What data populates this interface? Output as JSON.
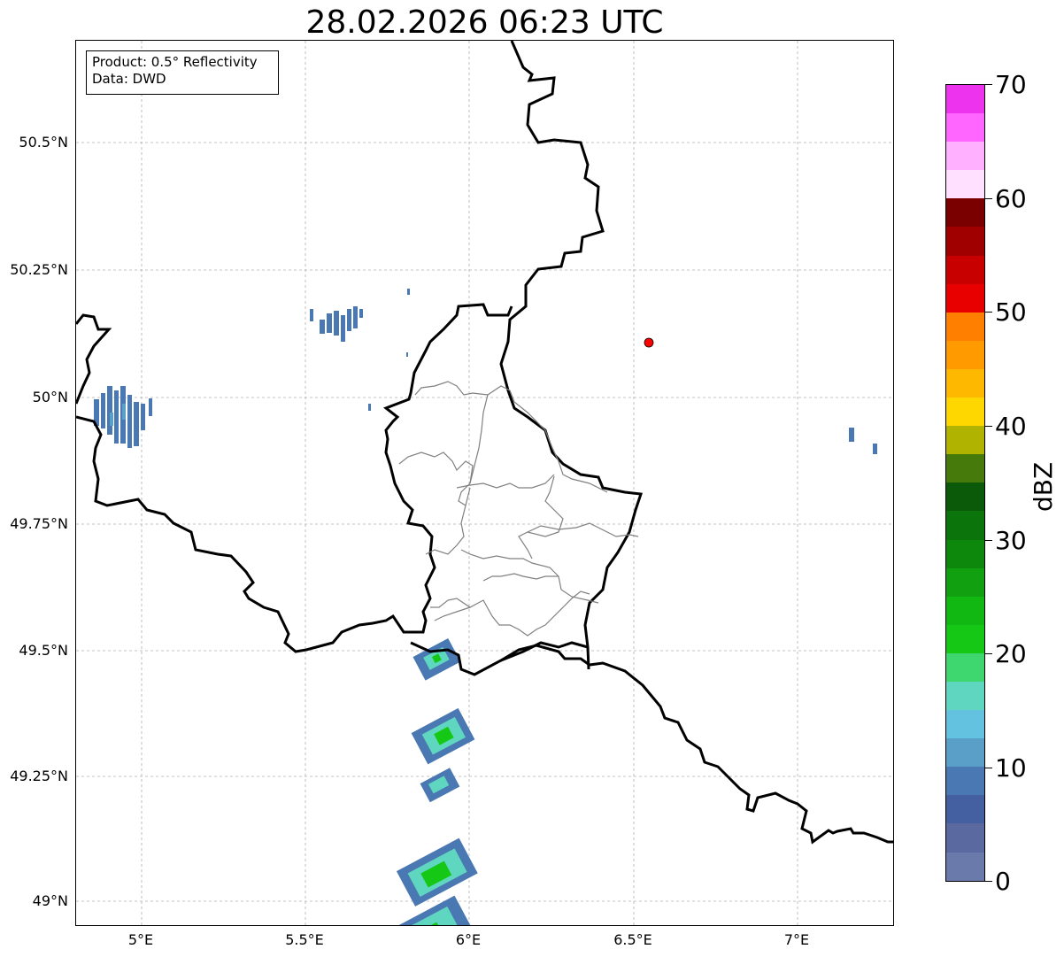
{
  "title": "28.02.2026 06:23 UTC",
  "info_box": {
    "product": "Product: 0.5° Reflectivity",
    "data": "Data: DWD"
  },
  "axes": {
    "lon_ticks": [
      "5°E",
      "5.5°E",
      "6°E",
      "6.5°E",
      "7°E"
    ],
    "lat_ticks": [
      "50.5°N",
      "50.25°N",
      "50°N",
      "49.75°N",
      "49.5°N",
      "49.25°N",
      "49°N"
    ]
  },
  "colorbar": {
    "unit": "dBZ",
    "tick_labels": [
      "70",
      "60",
      "50",
      "40",
      "30",
      "20",
      "10",
      "0"
    ],
    "range": [
      0,
      70
    ],
    "step": 2.5,
    "colors_top_to_bottom": [
      "#ee33ee",
      "#ff66ff",
      "#ffb0ff",
      "#ffe0ff",
      "#7a0000",
      "#a00000",
      "#c80000",
      "#e80000",
      "#ff7f00",
      "#ff9a00",
      "#ffb800",
      "#ffd700",
      "#b0b300",
      "#467a0a",
      "#0a5a0a",
      "#0b740b",
      "#0d880d",
      "#10a010",
      "#12b812",
      "#16c816",
      "#3ed66e",
      "#5fd6c0",
      "#63c2e0",
      "#5a9fc8",
      "#4a78b2",
      "#4460a0",
      "#5a6aa0",
      "#6a7aaa"
    ]
  },
  "marker": {
    "name": "radar-site",
    "color": "#ff0000",
    "lon": 6.55,
    "lat": 50.11
  }
}
